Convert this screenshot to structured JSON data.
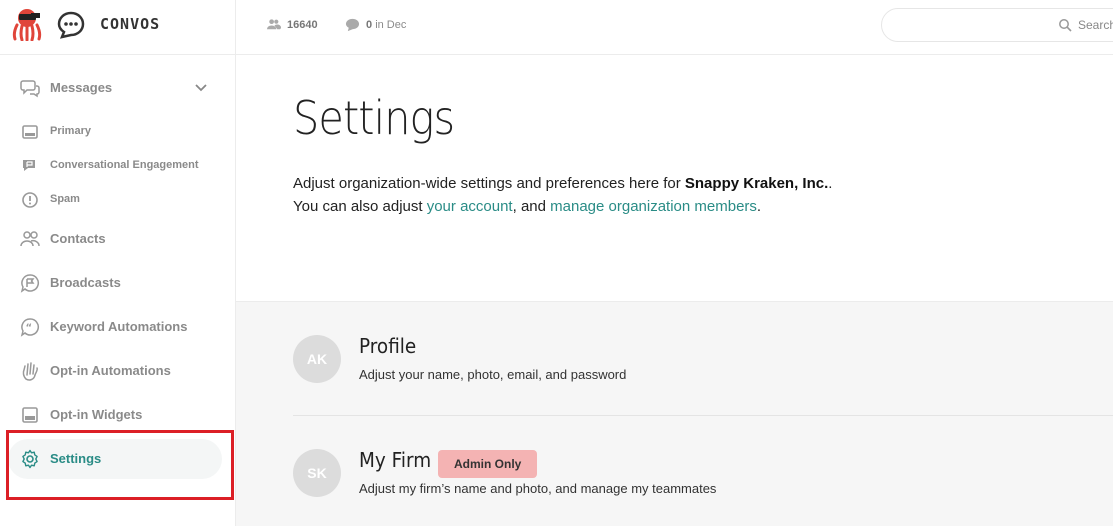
{
  "brand": {
    "name": "CONVOS"
  },
  "topbar": {
    "contacts_count": "16640",
    "messages_count": "0",
    "messages_suffix": "in Dec",
    "search_placeholder": "Search"
  },
  "sidebar": {
    "items": [
      {
        "label": "Messages",
        "icon": "chat-bubbles-icon"
      },
      {
        "label": "Primary",
        "icon": "inbox-icon"
      },
      {
        "label": "Conversational Engagement",
        "icon": "chat-flag-icon"
      },
      {
        "label": "Spam",
        "icon": "alert-circle-icon"
      },
      {
        "label": "Contacts",
        "icon": "people-icon"
      },
      {
        "label": "Broadcasts",
        "icon": "broadcast-flag-icon"
      },
      {
        "label": "Keyword Automations",
        "icon": "quote-bubble-icon"
      },
      {
        "label": "Opt-in Automations",
        "icon": "wave-hand-icon"
      },
      {
        "label": "Opt-in Widgets",
        "icon": "widget-icon"
      },
      {
        "label": "Settings",
        "icon": "gear-icon",
        "active": true
      }
    ]
  },
  "main": {
    "title": "Settings",
    "intro": {
      "text1": "Adjust organization-wide settings and preferences here for ",
      "org_name": "Snappy Kraken, Inc.",
      "text2": ". You can also adjust ",
      "link_account": "your account",
      "text3": ", and ",
      "link_members": "manage organization members",
      "text4": "."
    },
    "sections": [
      {
        "initials": "AK",
        "title": "Profile",
        "description": "Adjust your name, photo, email, and password"
      },
      {
        "initials": "SK",
        "title": "My Firm",
        "badge": "Admin Only",
        "description": "Adjust my firm’s name and photo, and manage my teammates"
      }
    ]
  },
  "colors": {
    "accent": "#2a8c86",
    "highlight_border": "#dc1f26",
    "badge_bg": "#f4b3b3"
  }
}
